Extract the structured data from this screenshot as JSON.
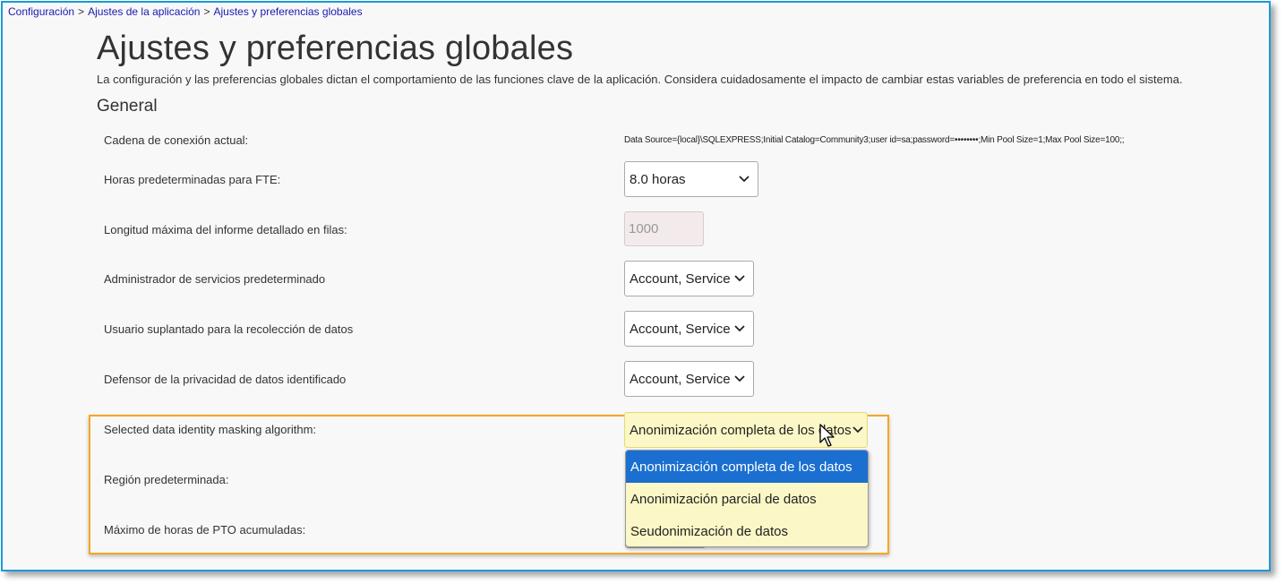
{
  "breadcrumb": {
    "items": [
      "Configuración",
      "Ajustes de la aplicación",
      "Ajustes y preferencias globales"
    ],
    "separator": ">"
  },
  "page": {
    "title": "Ajustes y preferencias globales",
    "description": "La configuración y las preferencias globales dictan el comportamiento de las funciones clave de la aplicación. Considera cuidadosamente el impacto de cambiar estas variables de preferencia en todo el sistema."
  },
  "section": {
    "title": "General"
  },
  "settings": {
    "connection_string": {
      "label": "Cadena de conexión actual:",
      "value": "Data Source={local}\\SQLEXPRESS;Initial Catalog=Community3;user id=sa;password=••••••••;Min Pool Size=1;Max Pool Size=100;;"
    },
    "fte_hours": {
      "label": "Horas predeterminadas para FTE:",
      "value": "8.0 horas"
    },
    "max_report_rows": {
      "label": "Longitud máxima del informe detallado en filas:",
      "placeholder": "1000"
    },
    "default_service_admin": {
      "label": "Administrador de servicios predeterminado",
      "value": "Account, Service"
    },
    "impersonated_user": {
      "label": "Usuario suplantado para la recolección de datos",
      "value": "Account, Service"
    },
    "privacy_advocate": {
      "label": "Defensor de la privacidad de datos identificado",
      "value": "Account, Service"
    },
    "masking_algorithm": {
      "label": "Selected data identity masking algorithm:",
      "value": "Anonimización completa de los datos",
      "options": [
        "Anonimización completa de los datos",
        "Anonimización parcial de datos",
        "Seudonimización de datos"
      ],
      "selected_index": 0
    },
    "default_region": {
      "label": "Región predeterminada:"
    },
    "max_pto_hours": {
      "label": "Máximo de horas de PTO acumuladas:"
    }
  },
  "colors": {
    "frame_border": "#1a9ad6",
    "highlight_border": "#f5a623",
    "link": "#1a1ab0",
    "dropdown_bg": "#fbf7c6",
    "option_selected_bg": "#1a6fd0"
  },
  "icons": {
    "select_chevron": "chevron-down-icon",
    "pointer": "mouse-pointer-icon"
  }
}
